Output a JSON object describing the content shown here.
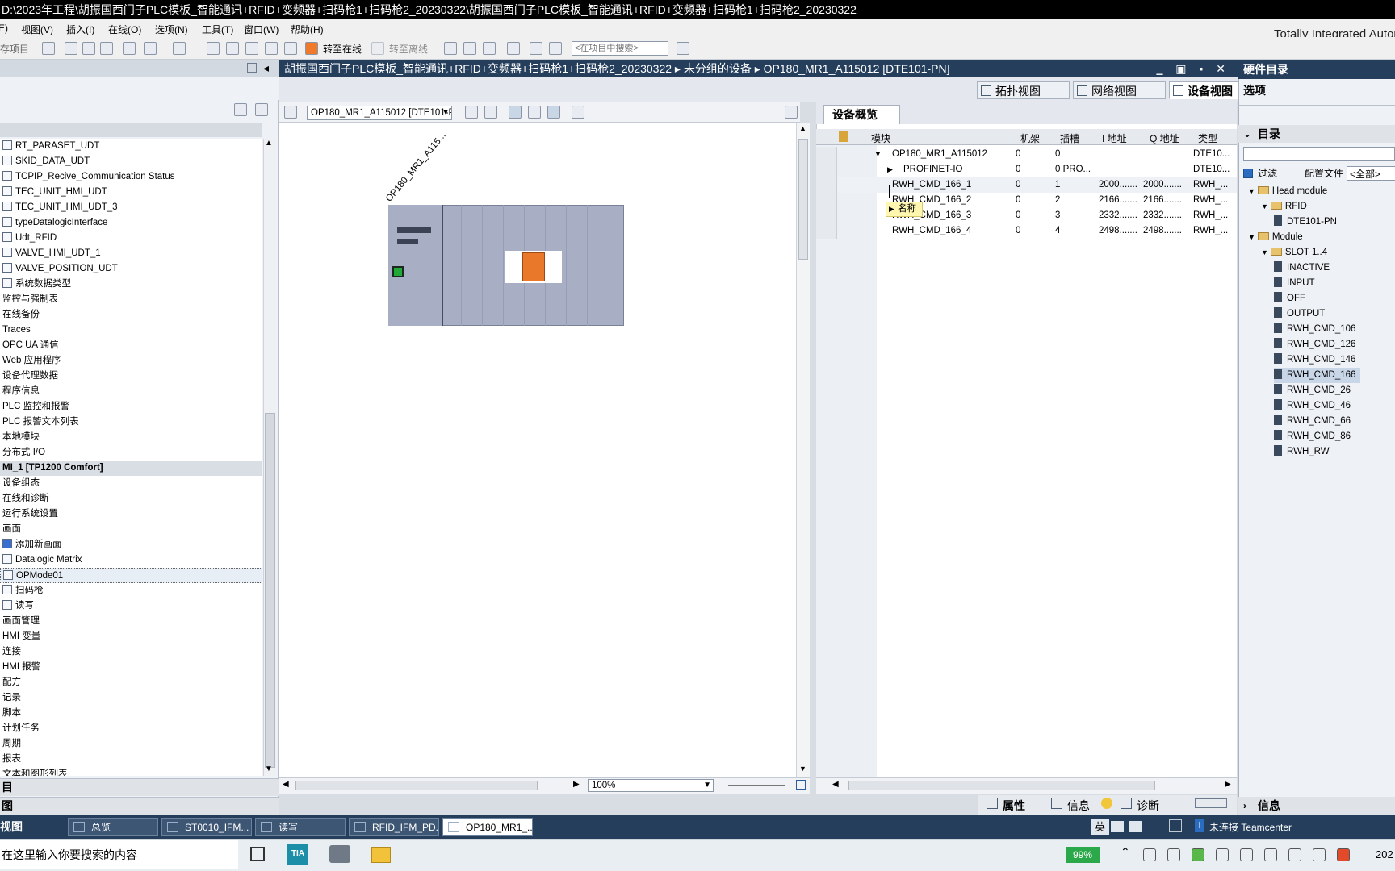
{
  "window": {
    "title": "D:\\2023年工程\\胡振国西门子PLC模板_智能通讯+RFID+变频器+扫码枪1+扫码枪2_20230322\\胡振国西门子PLC模板_智能通讯+RFID+变频器+扫码枪1+扫码枪2_20230322"
  },
  "menu": {
    "items": [
      "E)",
      "视图(V)",
      "插入(I)",
      "在线(O)",
      "选项(N)",
      "工具(T)",
      "窗口(W)",
      "帮助(H)"
    ]
  },
  "toolbar": {
    "save_project": "存项目",
    "go_online": "转至在线",
    "go_offline": "转至离线",
    "search_placeholder": "<在项目中搜索>",
    "brand": "Totally Integrated Automation"
  },
  "project_tree": {
    "items": [
      {
        "label": "RT_PARASET_UDT",
        "icon": "udt-icon",
        "indent": 1
      },
      {
        "label": "SKID_DATA_UDT",
        "icon": "udt-icon",
        "indent": 1
      },
      {
        "label": "TCPIP_Recive_Communication Status",
        "icon": "udt-icon",
        "indent": 1
      },
      {
        "label": "TEC_UNIT_HMI_UDT",
        "icon": "udt-icon",
        "indent": 1
      },
      {
        "label": "TEC_UNIT_HMI_UDT_3",
        "icon": "udt-icon",
        "indent": 1
      },
      {
        "label": "typeDatalogicInterface",
        "icon": "udt-icon",
        "indent": 1
      },
      {
        "label": "Udt_RFID",
        "icon": "udt-icon",
        "indent": 1
      },
      {
        "label": "VALVE_HMI_UDT_1",
        "icon": "udt-icon",
        "indent": 1
      },
      {
        "label": "VALVE_POSITION_UDT",
        "icon": "udt-icon",
        "indent": 1
      },
      {
        "label": "系统数据类型",
        "icon": "folder-icon",
        "indent": 1
      },
      {
        "label": "监控与强制表",
        "icon": "",
        "indent": 0
      },
      {
        "label": "在线备份",
        "icon": "",
        "indent": 0
      },
      {
        "label": "Traces",
        "icon": "",
        "indent": 0
      },
      {
        "label": "OPC UA 通信",
        "icon": "",
        "indent": 0
      },
      {
        "label": "Web 应用程序",
        "icon": "",
        "indent": 0
      },
      {
        "label": "设备代理数据",
        "icon": "",
        "indent": 0
      },
      {
        "label": "程序信息",
        "icon": "",
        "indent": 0
      },
      {
        "label": "PLC 监控和报警",
        "icon": "",
        "indent": 0
      },
      {
        "label": "PLC 报警文本列表",
        "icon": "",
        "indent": 0
      },
      {
        "label": "本地模块",
        "icon": "",
        "indent": 0
      },
      {
        "label": "分布式 I/O",
        "icon": "",
        "indent": 0
      },
      {
        "label": "MI_1 [TP1200 Comfort]",
        "icon": "",
        "indent": 0,
        "header": true
      },
      {
        "label": "设备组态",
        "icon": "",
        "indent": 0
      },
      {
        "label": "在线和诊断",
        "icon": "",
        "indent": 0
      },
      {
        "label": "运行系统设置",
        "icon": "",
        "indent": 0
      },
      {
        "label": "画面",
        "icon": "",
        "indent": 0
      },
      {
        "label": "添加新画面",
        "icon": "add-screen-icon",
        "indent": 1
      },
      {
        "label": "Datalogic Matrix",
        "icon": "screen-icon",
        "indent": 1
      },
      {
        "label": "OPMode01",
        "icon": "screen-icon",
        "indent": 1,
        "selected": true
      },
      {
        "label": "扫码枪",
        "icon": "screen-icon",
        "indent": 1
      },
      {
        "label": "读写",
        "icon": "screen-icon",
        "indent": 1
      },
      {
        "label": "画面管理",
        "icon": "",
        "indent": 0
      },
      {
        "label": "HMI 变量",
        "icon": "",
        "indent": 0
      },
      {
        "label": "连接",
        "icon": "",
        "indent": 0
      },
      {
        "label": "HMI 报警",
        "icon": "",
        "indent": 0
      },
      {
        "label": "配方",
        "icon": "",
        "indent": 0
      },
      {
        "label": "记录",
        "icon": "",
        "indent": 0
      },
      {
        "label": "脚本",
        "icon": "",
        "indent": 0
      },
      {
        "label": "计划任务",
        "icon": "",
        "indent": 0
      },
      {
        "label": "周期",
        "icon": "",
        "indent": 0
      },
      {
        "label": "报表",
        "icon": "",
        "indent": 0
      },
      {
        "label": "文本和图形列表",
        "icon": "",
        "indent": 0
      }
    ],
    "bottom1": "目",
    "bottom2": "图"
  },
  "editor": {
    "breadcrumb": "胡振国西门子PLC模板_智能通讯+RFID+变频器+扫码枪1+扫码枪2_20230322  ▸  未分组的设备  ▸  OP180_MR1_A115012 [DTE101-PN]",
    "tabs": [
      "拓扑视图",
      "网络视图",
      "设备视图"
    ],
    "device_select": "OP180_MR1_A115012 [DTE101-PN]",
    "device_label": "OP180_MR1_A115...",
    "zoom": "100%"
  },
  "overview": {
    "tab": "设备概览",
    "columns": [
      "模块",
      "机架",
      "插槽",
      "I 地址",
      "Q 地址",
      "类型"
    ],
    "rows": [
      {
        "module": "OP180_MR1_A115012",
        "rack": "0",
        "slot": "0",
        "i": "",
        "q": "",
        "type": "DTE10...",
        "expand": "down",
        "indent": 1
      },
      {
        "module": "PROFINET-IO",
        "rack": "0",
        "slot": "0 PRO...",
        "i": "",
        "q": "",
        "type": "DTE10...",
        "expand": "right",
        "indent": 2
      },
      {
        "module": "RWH_CMD_166_1",
        "rack": "0",
        "slot": "1",
        "i": "2000.......",
        "q": "2000.......",
        "type": "RWH_...",
        "expand": "",
        "indent": 1
      },
      {
        "module": "RWH_CMD_166_2",
        "rack": "0",
        "slot": "2",
        "i": "2166.......",
        "q": "2166.......",
        "type": "RWH_...",
        "expand": "",
        "indent": 1
      },
      {
        "module": "RWH_CMD_166_3",
        "rack": "0",
        "slot": "3",
        "i": "2332.......",
        "q": "2332.......",
        "type": "RWH_...",
        "expand": "",
        "indent": 1
      },
      {
        "module": "RWH_CMD_166_4",
        "rack": "0",
        "slot": "4",
        "i": "2498.......",
        "q": "2498.......",
        "type": "RWH_...",
        "expand": "",
        "indent": 1
      }
    ],
    "tooltip": "名称"
  },
  "catalog": {
    "title": "硬件目录",
    "options": "选项",
    "section": "目录",
    "filter": "过滤",
    "profile_label": "配置文件",
    "profile_value": "<全部>",
    "tree": [
      {
        "label": "Head module",
        "type": "folder",
        "indent": 0
      },
      {
        "label": "RFID",
        "type": "folder",
        "indent": 1
      },
      {
        "label": "DTE101-PN",
        "type": "module",
        "indent": 2
      },
      {
        "label": "Module",
        "type": "folder",
        "indent": 0
      },
      {
        "label": "SLOT 1..4",
        "type": "folder",
        "indent": 1
      },
      {
        "label": "INACTIVE",
        "type": "module",
        "indent": 2
      },
      {
        "label": "INPUT",
        "type": "module",
        "indent": 2
      },
      {
        "label": "OFF",
        "type": "module",
        "indent": 2
      },
      {
        "label": "OUTPUT",
        "type": "module",
        "indent": 2
      },
      {
        "label": "RWH_CMD_106",
        "type": "module",
        "indent": 2
      },
      {
        "label": "RWH_CMD_126",
        "type": "module",
        "indent": 2
      },
      {
        "label": "RWH_CMD_146",
        "type": "module",
        "indent": 2
      },
      {
        "label": "RWH_CMD_166",
        "type": "module",
        "indent": 2,
        "selected": true
      },
      {
        "label": "RWH_CMD_26",
        "type": "module",
        "indent": 2
      },
      {
        "label": "RWH_CMD_46",
        "type": "module",
        "indent": 2
      },
      {
        "label": "RWH_CMD_66",
        "type": "module",
        "indent": 2
      },
      {
        "label": "RWH_CMD_86",
        "type": "module",
        "indent": 2
      },
      {
        "label": "RWH_RW",
        "type": "module",
        "indent": 2
      }
    ],
    "info": "信息"
  },
  "inspector": {
    "properties": "属性",
    "info": "信息",
    "diagnostics": "诊断"
  },
  "portal_bar": {
    "portal_view": "视图",
    "tabs": [
      "总览",
      "ST0010_IFM...",
      "读写",
      "RFID_IFM_PD...",
      "OP180_MR1_..."
    ],
    "teamcenter": "未连接 Teamcenter"
  },
  "ime": {
    "lang": "英"
  },
  "taskbar": {
    "search_placeholder": "在这里输入你要搜索的内容",
    "battery": "99%",
    "clock": "202"
  },
  "colors": {
    "accent": "#243e5c",
    "highlight": "#e8c26a",
    "tooltip": "#fff6b0"
  }
}
